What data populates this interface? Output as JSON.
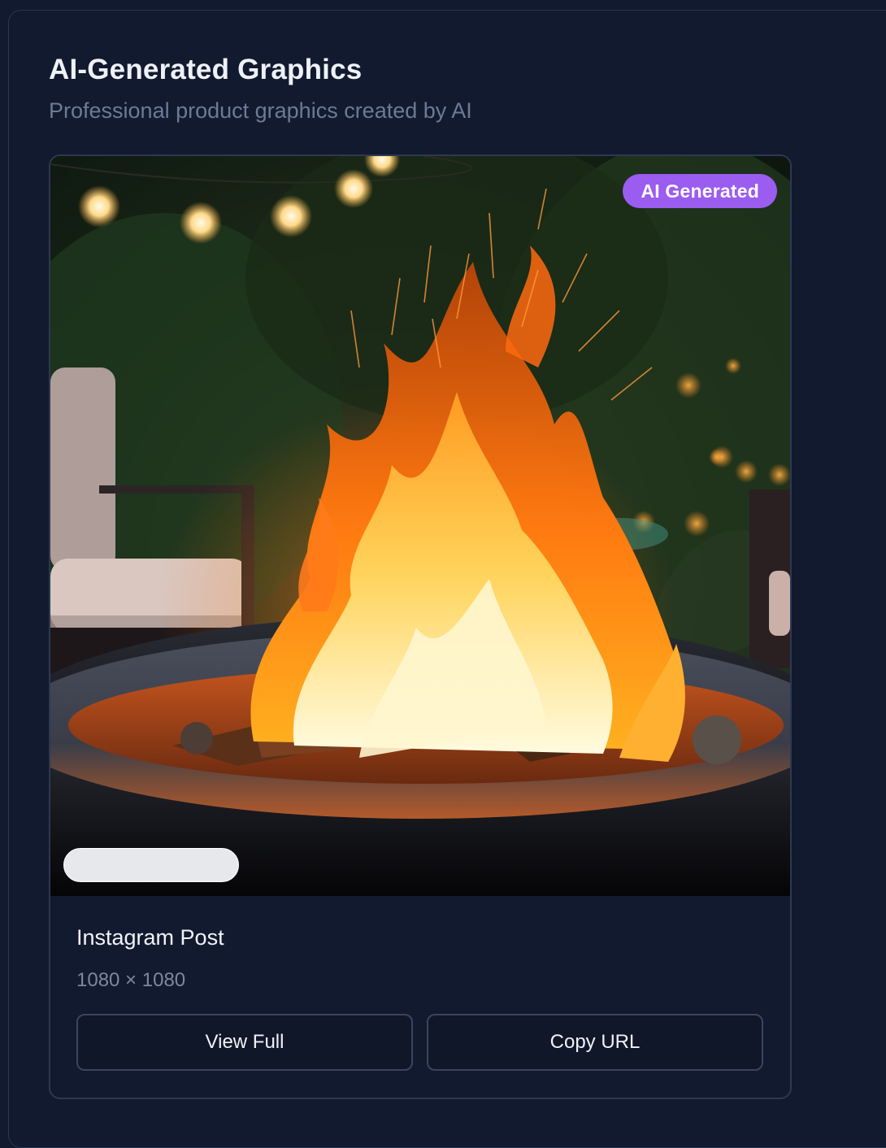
{
  "section": {
    "title": "AI-Generated Graphics",
    "subtitle": "Professional product graphics created by AI"
  },
  "card": {
    "badge": "AI Generated",
    "title": "Instagram Post",
    "dimensions": "1080 × 1080",
    "view_full_label": "View Full",
    "copy_url_label": "Copy URL"
  },
  "colors": {
    "background": "#111a2e",
    "badge": "#9b5cf0",
    "card_border": "#2d3852",
    "button_border": "#3a455e",
    "subtitle": "#6d7a96"
  },
  "image": {
    "subject": "fire-pit-photo"
  }
}
